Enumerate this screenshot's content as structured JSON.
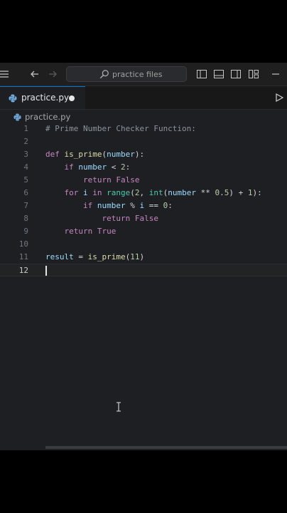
{
  "titlebar": {
    "search_label": "practice files",
    "icons": [
      "menu-icon",
      "back-arrow-icon",
      "forward-arrow-icon",
      "search-icon",
      "toggle-primary-sidebar-icon",
      "toggle-panel-icon",
      "toggle-secondary-sidebar-icon",
      "customize-layout-icon",
      "minimize-icon"
    ]
  },
  "tab": {
    "label": "practice.py",
    "icon": "python-file-icon",
    "unsaved": true
  },
  "breadcrumb": {
    "file": "practice.py"
  },
  "editor": {
    "line_numbers": [
      "1",
      "2",
      "3",
      "4",
      "5",
      "6",
      "7",
      "8",
      "9",
      "10",
      "11",
      "12"
    ],
    "current_line": 12,
    "lines": [
      "# Prime Number Checker Function:",
      "",
      "def is_prime(number):",
      "    if number < 2:",
      "        return False",
      "    for i in range(2, int(number ** 0.5) + 1):",
      "        if number % i == 0:",
      "            return False",
      "    return True",
      "",
      "result = is_prime(11)",
      ""
    ]
  },
  "colors": {
    "background": "#1e1f22",
    "accent": "#0078d4",
    "keyword": "#c586c0",
    "function": "#dcdcaa",
    "number": "#b5cea8"
  }
}
